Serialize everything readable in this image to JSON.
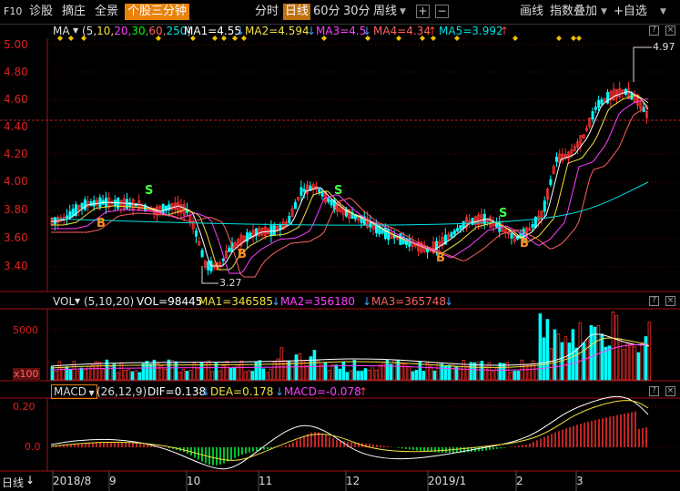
{
  "toolbar": {
    "f10": "F10",
    "diagnose": "诊股",
    "pick": "摘庄",
    "panorama": "全景",
    "indiv3min": "个股三分钟",
    "period_intraday": "分时",
    "period_daily": "日线",
    "period_60": "60分",
    "period_30": "30分",
    "period_weekly": "周线",
    "draw_line": "画线",
    "index_overlay": "指数叠加",
    "add_watchlist": "+自选",
    "colors": {
      "accent": "#e8820c",
      "ma_up": "#e02020",
      "ma_down": "#00c8ff"
    }
  },
  "ma_header": {
    "label": "MA",
    "params_prefix": "(5,",
    "p10": "10,",
    "p20": "20,",
    "p30": "30,",
    "p60": "60,",
    "p250": "250",
    "params_suffix": ")",
    "ma1": "MA1=4.55",
    "ma2": "MA2=4.594",
    "ma3": "MA3=4.5",
    "ma4": "MA4=4.34",
    "ma5": "MA5=3.992"
  },
  "vol_header": {
    "label": "VOL",
    "params": "(5,10,20)",
    "vol": "VOL=98445",
    "ma1": "MA1=346585",
    "ma2": "MA2=356180",
    "ma3": "MA3=365748"
  },
  "macd_header": {
    "label": "MACD",
    "params": "(26,12,9)",
    "dif": "DIF=0.138",
    "dea": "DEA=0.178",
    "macd": "MACD=-0.078"
  },
  "price_axis": [
    "5.00",
    "4.80",
    "4.60",
    "4.40",
    "4.20",
    "4.00",
    "3.80",
    "3.60",
    "3.40"
  ],
  "vol_axis": [
    "5000",
    "x100"
  ],
  "macd_axis": [
    "0.20",
    "0.0"
  ],
  "annotations": {
    "high": "4.97",
    "low": "3.27",
    "buy": "B",
    "sell": "S"
  },
  "bottom": {
    "period_label": "日线",
    "dates": [
      "2018/8",
      "9",
      "10",
      "11",
      "12",
      "2019/1",
      "2",
      "3"
    ]
  }
}
